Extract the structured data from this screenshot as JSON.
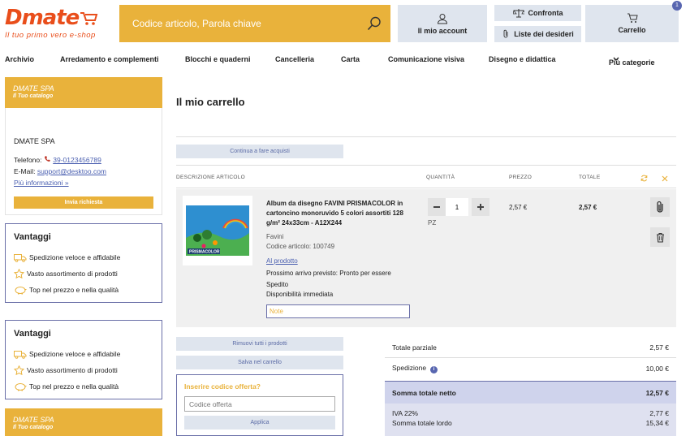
{
  "header": {
    "logo_text": "Dmate",
    "tagline": "Il tuo primo vero e-shop",
    "search_placeholder": "Codice articolo, Parola chiave",
    "account_label": "Il mio account",
    "compare_label": "Confronta",
    "wishlist_label": "Liste dei desideri",
    "cart_label": "Carrello",
    "cart_count": "1",
    "colors": {
      "brand": "#e94e1b",
      "accent": "#e9b23b",
      "button_bg": "#dfe5ee",
      "badge": "#5866b0"
    }
  },
  "nav": {
    "items": [
      "Archivio",
      "Arredamento e complementi",
      "Blocchi e quaderni",
      "Cancelleria",
      "Carta",
      "Comunicazione visiva",
      "Disegno e didattica"
    ],
    "more_label": "Più categorie"
  },
  "sidebar": {
    "card_title": "DMATE SPA",
    "card_subtitle": "Il Tuo catalogo",
    "company": "DMATE SPA",
    "phone_label": "Telefono:",
    "phone": "39-0123456789",
    "email_label": "E-Mail:",
    "email": "support@desktoo.com",
    "more_info": "Più informazioni »",
    "request_button": "Invia richiesta",
    "advantages": [
      {
        "title": "Vantaggi",
        "items": [
          {
            "icon": "truck-icon",
            "text": "Spedizione veloce e affidabile"
          },
          {
            "icon": "star-icon",
            "text": "Vasto assortimento di prodotti"
          },
          {
            "icon": "piggy-bank-icon",
            "text": "Top nel prezzo e nella qualità"
          }
        ]
      },
      {
        "title": "Vantaggi",
        "items": [
          {
            "icon": "truck-icon",
            "text": "Spedizione veloce e affidabile"
          },
          {
            "icon": "star-icon",
            "text": "Vasto assortimento di prodotti"
          },
          {
            "icon": "piggy-bank-icon",
            "text": "Top nel prezzo e nella qualità"
          }
        ]
      }
    ],
    "card2_title": "DMATE SPA",
    "card2_subtitle": "Il Tuo catalogo"
  },
  "cart": {
    "title": "Il mio carrello",
    "continue_button": "Continua a fare acquisti",
    "columns": {
      "description": "DESCRIZIONE ARTICOLO",
      "quantity": "QUANTITÀ",
      "price": "PREZZO",
      "total": "TOTALE"
    },
    "item": {
      "name": "Album da disegno FAVINI PRISMACOLOR in cartoncino monoruvido 5 colori assortiti 128 g/m² 24x33cm - A12X244",
      "brand": "Favini",
      "code": "Codice articolo: 100749",
      "product_link": "Al prodotto",
      "arrival_line1": "Prossimo arrivo previsto: Pronto per essere",
      "arrival_line2": "Spedito",
      "availability": "Disponibilità immediata",
      "note_placeholder": "Note",
      "quantity": "1",
      "unit": "PZ",
      "unit_price": "2,57 €",
      "total_price": "2,57 €",
      "image_brand": "PRISMACOLOR"
    },
    "remove_all": "Rimuovi tutti i prodotti",
    "save_cart": "Salva nel carrello",
    "promo_title": "Inserire codice offerta?",
    "promo_placeholder": "Codice offerta",
    "apply_button": "Applica"
  },
  "totals": {
    "subtotal_label": "Totale parziale",
    "subtotal": "2,57 €",
    "shipping_label": "Spedizione",
    "shipping": "10,00 €",
    "net_label": "Somma totale netto",
    "net": "12,57 €",
    "vat_label": "IVA 22%",
    "vat": "2,77 €",
    "gross_label": "Somma totale lordo",
    "gross": "15,34 €"
  }
}
